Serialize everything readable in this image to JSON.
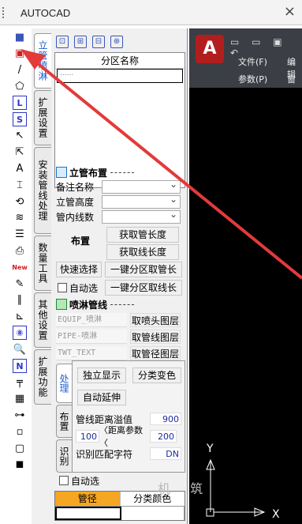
{
  "window": {
    "title": "AUTOCAD",
    "close": "×"
  },
  "tabs": [
    "立管喷淋",
    "扩展设置",
    "安装管线处理",
    "数量工具",
    "其他设置",
    "扩展功能"
  ],
  "toolbar_icons": [
    {
      "name": "square-icon",
      "glyph": "■"
    },
    {
      "name": "panel-icon",
      "glyph": "▣"
    },
    {
      "name": "line-icon",
      "glyph": "/"
    },
    {
      "name": "pentagon-icon",
      "glyph": "⬠"
    },
    {
      "name": "l-icon",
      "glyph": "L"
    },
    {
      "name": "s-icon",
      "glyph": "S"
    },
    {
      "name": "arrow-cursor-icon",
      "glyph": "↖"
    },
    {
      "name": "select-cursor-icon",
      "glyph": "⇱"
    },
    {
      "name": "text-icon",
      "glyph": "A"
    },
    {
      "name": "dimension-icon",
      "glyph": "⌶"
    },
    {
      "name": "refresh-icon",
      "glyph": "⟲"
    },
    {
      "name": "layers-icon",
      "glyph": "≋"
    },
    {
      "name": "stack-icon",
      "glyph": "☰"
    },
    {
      "name": "print-icon",
      "glyph": "⎙"
    },
    {
      "name": "new-icon",
      "glyph": "New"
    },
    {
      "name": "brush-icon",
      "glyph": "✎"
    },
    {
      "name": "parallel-icon",
      "glyph": "∥"
    },
    {
      "name": "axis-icon",
      "glyph": "⊾"
    },
    {
      "name": "eight-icon",
      "glyph": "⑧"
    },
    {
      "name": "search-zoom-icon",
      "glyph": "🔍"
    },
    {
      "name": "n-icon",
      "glyph": "N"
    },
    {
      "name": "t-pipe-icon",
      "glyph": "╤"
    },
    {
      "name": "grid-icon",
      "glyph": "▦"
    },
    {
      "name": "node-icon",
      "glyph": "⊶"
    },
    {
      "name": "small-square-icon",
      "glyph": "▫"
    },
    {
      "name": "box-icon",
      "glyph": "▢"
    },
    {
      "name": "stop-icon",
      "glyph": "◼"
    }
  ],
  "zone": {
    "header": "分区名称",
    "input_value": "......"
  },
  "riser": {
    "title": "立管布置",
    "fields": [
      {
        "label": "备注名称",
        "value": ""
      },
      {
        "label": "立管高度",
        "value": ""
      },
      {
        "label": "管内线数",
        "value": ""
      }
    ],
    "layout_button": "布置",
    "get_pipe_length": "获取管长度",
    "get_line_length": "获取线长度",
    "quick_select": "快速选择",
    "one_click_pipe": "一键分区取管长",
    "auto_select": "自动选",
    "one_click_line": "一键分区取线长"
  },
  "sprinkler": {
    "title": "喷淋管线",
    "layers": [
      {
        "name": "EQUIP_喷淋",
        "button": "取喷头图层"
      },
      {
        "name": "PIPE-喷淋",
        "button": "取管线图层"
      },
      {
        "name": "TWT_TEXT",
        "button": "取管径图层"
      }
    ],
    "sub_tabs": [
      "处理",
      "布置",
      "识别"
    ],
    "independent_display": "独立显示",
    "category_color": "分类变色",
    "auto_extend": "自动延伸",
    "overflow_label": "管线距离溢值",
    "overflow_value": "900",
    "range_left": "100",
    "range_label": "〈距离参数〈",
    "range_right": "200",
    "match_label": "识别匹配字符",
    "match_value": "DN"
  },
  "bottom": {
    "auto_select": "自动选",
    "col_diameter": "管径",
    "col_color": "分类颜色"
  },
  "cad": {
    "menu_file": "文件(F)",
    "menu_edit": "编辑",
    "menu_params": "参数(P)",
    "menu_window": "窗口",
    "axis_y": "Y",
    "axis_x": "X",
    "watermark": "机 筑"
  },
  "colors": {
    "annotation_arrow": "#e33a3a",
    "accent_blue": "#1e5fd0",
    "orange_header": "#f5a623",
    "cad_background": "#000000"
  }
}
